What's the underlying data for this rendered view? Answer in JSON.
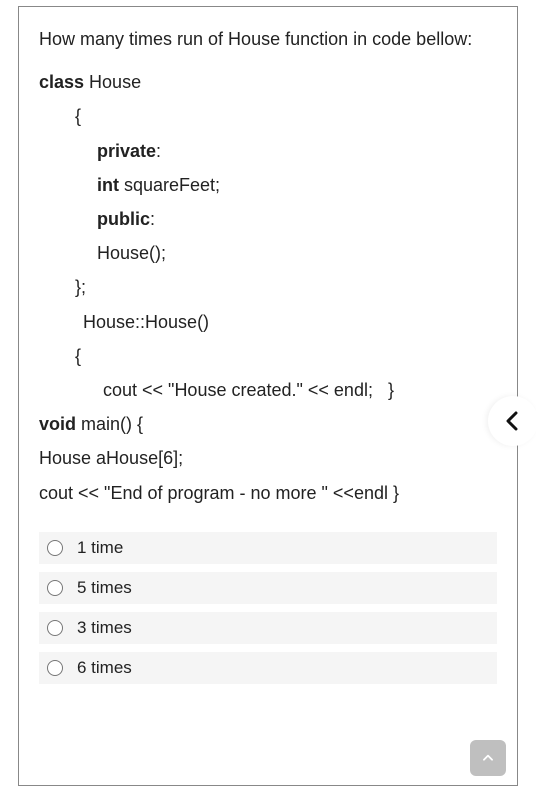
{
  "question": {
    "prompt": "How many times run of House function in code bellow:",
    "code": {
      "l1a": "class",
      "l1b": " House",
      "l2": "{",
      "l3a": "private",
      "l3b": ":",
      "l4a": "int",
      "l4b": " squareFeet;",
      "l5a": "public",
      "l5b": ":",
      "l6": "House();",
      "l7": "};",
      "l8": "House::House()",
      "l9": "{",
      "l10": "cout << \"House created.\" << endl;   }",
      "l11a": "void",
      "l11b": " main() {",
      "l12": "House aHouse[6];",
      "l13": "cout << \"End of program - no more \" <<endl }"
    },
    "options": [
      {
        "label": "1 time"
      },
      {
        "label": "5 times"
      },
      {
        "label": "3 times"
      },
      {
        "label": "6 times"
      }
    ]
  }
}
